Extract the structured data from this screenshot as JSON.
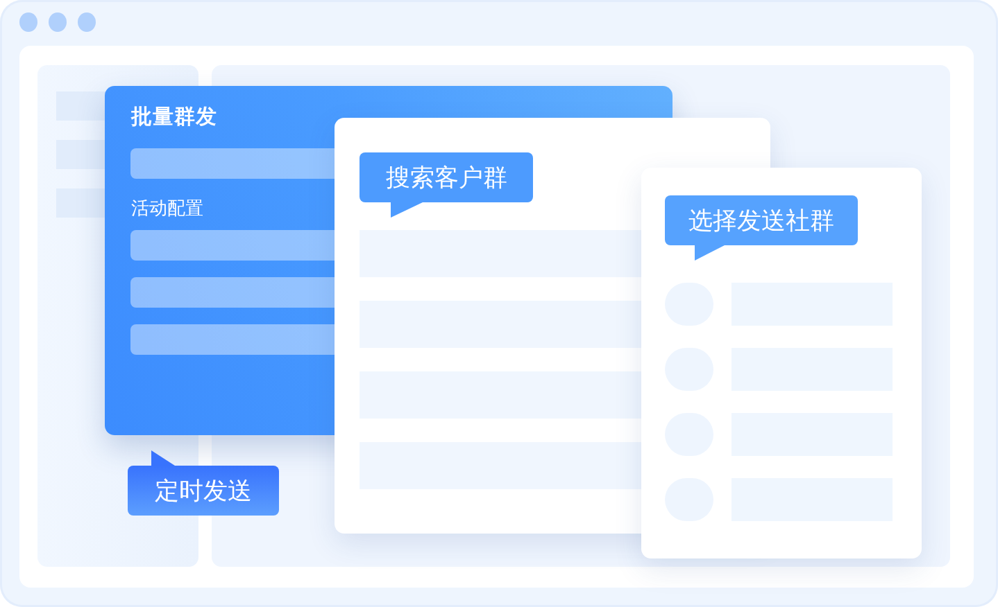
{
  "batch_panel": {
    "title": "批量群发",
    "section_label": "活动配置",
    "callout": "定时发送"
  },
  "search_panel": {
    "callout": "搜索客户群"
  },
  "select_panel": {
    "callout": "选择发送社群"
  }
}
